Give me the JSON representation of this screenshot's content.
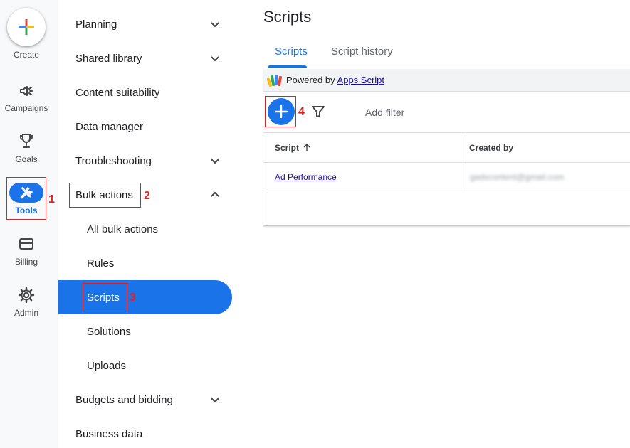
{
  "rail": {
    "create_label": "Create",
    "items": [
      {
        "label": "Campaigns",
        "icon": "megaphone-icon"
      },
      {
        "label": "Goals",
        "icon": "trophy-icon"
      },
      {
        "label": "Tools",
        "icon": "tools-icon"
      },
      {
        "label": "Billing",
        "icon": "credit-card-icon"
      },
      {
        "label": "Admin",
        "icon": "gear-icon"
      }
    ]
  },
  "nav": {
    "items": [
      {
        "label": "Planning",
        "chevron": "down"
      },
      {
        "label": "Shared library",
        "chevron": "down"
      },
      {
        "label": "Content suitability"
      },
      {
        "label": "Data manager"
      },
      {
        "label": "Troubleshooting",
        "chevron": "down"
      },
      {
        "label": "Bulk actions",
        "chevron": "up"
      },
      {
        "label": "All bulk actions"
      },
      {
        "label": "Rules"
      },
      {
        "label": "Scripts",
        "active": true
      },
      {
        "label": "Solutions"
      },
      {
        "label": "Uploads"
      },
      {
        "label": "Budgets and bidding",
        "chevron": "down"
      },
      {
        "label": "Business data"
      }
    ]
  },
  "main": {
    "title": "Scripts",
    "tabs": [
      {
        "label": "Scripts",
        "active": true
      },
      {
        "label": "Script history"
      }
    ],
    "powered": {
      "prefix": "Powered by ",
      "link": "Apps Script"
    },
    "toolbar": {
      "add_filter": "Add filter"
    },
    "table": {
      "columns": [
        "Script",
        "Created by"
      ],
      "rows": [
        {
          "script": "Ad Performance",
          "created_by": "gadscontent@gmail.com"
        }
      ]
    }
  },
  "annotations": {
    "n1": "1",
    "n2": "2",
    "n3": "3",
    "n4": "4"
  },
  "colors": {
    "accent": "#1a73e8",
    "annotation": "#e02020"
  }
}
